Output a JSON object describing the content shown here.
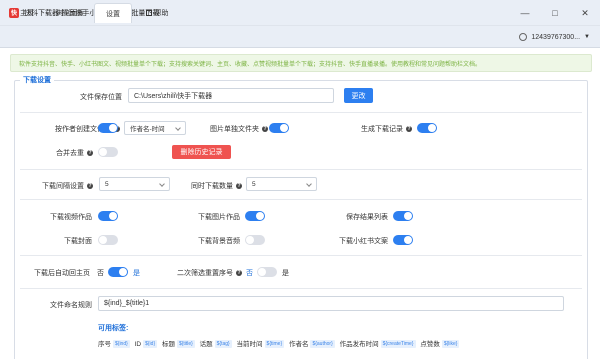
{
  "window": {
    "title": "快抖下载器-抖音快手小红书去水印批量下载",
    "app_icon": "快",
    "controls": [
      "minimize-icon",
      "maximize-icon",
      "close-icon"
    ]
  },
  "menu": {
    "tabs": [
      {
        "label": "主页",
        "active": false
      },
      {
        "label": "浏览面板",
        "active": false
      },
      {
        "label": "设置",
        "active": true
      },
      {
        "label": "帮助",
        "active": false
      }
    ],
    "user": "12439767300..."
  },
  "notice": "软件支持抖音、快手、小红书图文、视频批量单个下载；支持搜索关键词、主页、收藏、点赞视频批量单个下载；支持抖音、快手直播录播。使用教程和常见问题帮助栏文档。",
  "settings": {
    "section_title": "下载设置",
    "save_path": {
      "label": "文件保存位置",
      "value": "C:\\Users\\zhili\\快手下载器",
      "button": "更改"
    },
    "author_folder": {
      "label": "按作者创建文件夹",
      "on": true,
      "select": "作者名-时间"
    },
    "image_folder": {
      "label": "图片单独文件夹",
      "on": true
    },
    "record": {
      "label": "生成下载记录",
      "on": true
    },
    "merge_dedupe": {
      "label": "合并去重",
      "on": false,
      "button": "删除历史记录"
    },
    "interval": {
      "label": "下载间隔设置",
      "value": "5"
    },
    "concurrent": {
      "label": "同时下载数量",
      "value": "5"
    },
    "dl_video": {
      "label": "下载视频作品",
      "on": true
    },
    "dl_image": {
      "label": "下载图片作品",
      "on": true
    },
    "save_list": {
      "label": "保存结果列表",
      "on": true
    },
    "dl_cover": {
      "label": "下载封面",
      "on": false
    },
    "dl_bgm": {
      "label": "下载背景音频",
      "on": false
    },
    "dl_xhs_text": {
      "label": "下载小红书文案",
      "on": true
    },
    "auto_back": {
      "label": "下载后自动回主页",
      "no": "否",
      "yes": "是",
      "on": true
    },
    "secondary_sort": {
      "label": "二次筛选重置序号",
      "no": "否",
      "yes": "是",
      "on": false
    },
    "naming": {
      "label": "文件命名规则",
      "value": "${ind}_${title}1"
    },
    "tags_title": "可用标签:",
    "tags": [
      {
        "name": "序号",
        "tag": "${ind}"
      },
      {
        "name": "ID",
        "tag": "${id}"
      },
      {
        "name": "标题",
        "tag": "${title}"
      },
      {
        "name": "话题",
        "tag": "${tag}"
      },
      {
        "name": "当前时间",
        "tag": "${time}"
      },
      {
        "name": "作者名",
        "tag": "${author}"
      },
      {
        "name": "作品发布时间",
        "tag": "${createTime}"
      },
      {
        "name": "点赞数",
        "tag": "${like}"
      }
    ]
  },
  "colors": {
    "accent": "#2d7ff0",
    "danger": "#ef5350",
    "notice_text": "#7cb342"
  }
}
